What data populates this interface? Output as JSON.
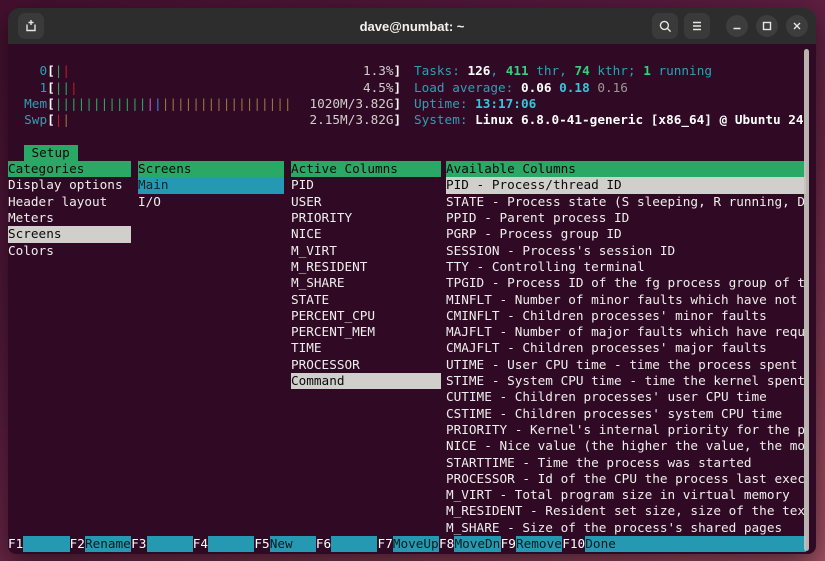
{
  "window": {
    "title": "dave@numbat: ~"
  },
  "titlebar": {
    "icons": [
      "new-tab",
      "search",
      "menu",
      "minimize",
      "maximize",
      "close"
    ]
  },
  "meters": [
    {
      "label": "0",
      "value": "1.3%",
      "bars": [
        [
          "green",
          1
        ],
        [
          "red",
          1
        ]
      ]
    },
    {
      "label": "1",
      "value": "4.5%",
      "bars": [
        [
          "green",
          2
        ],
        [
          "red",
          1
        ]
      ]
    },
    {
      "label": "Mem",
      "value": "1020M/3.82G",
      "bars": [
        [
          "green",
          12
        ],
        [
          "magenta",
          1
        ],
        [
          "blue",
          1
        ],
        [
          "yellow",
          17
        ]
      ]
    },
    {
      "label": "Swp",
      "value": "2.15M/3.82G",
      "bars": [
        [
          "red",
          1
        ],
        [
          "yellow",
          1
        ]
      ]
    }
  ],
  "header_info": [
    [
      [
        "Tasks: ",
        "cy"
      ],
      [
        "126",
        "wb"
      ],
      [
        ", ",
        "cy"
      ],
      [
        "411",
        "gb"
      ],
      [
        " thr, ",
        "cy"
      ],
      [
        "74",
        "gb"
      ],
      [
        " kthr; ",
        "cy"
      ],
      [
        "1",
        "gb"
      ],
      [
        " running",
        "cy"
      ]
    ],
    [
      [
        "Load average: ",
        "cy"
      ],
      [
        "0.06 ",
        "wb"
      ],
      [
        "0.18 ",
        "cb"
      ],
      [
        "0.16",
        "dim"
      ]
    ],
    [
      [
        "Uptime: ",
        "cy"
      ],
      [
        "13:17:06",
        "cb"
      ]
    ],
    [
      [
        "System: ",
        "cy"
      ],
      [
        "Linux 6.8.0-41-generic [x86_64] @ Ubuntu 24",
        "wb"
      ]
    ]
  ],
  "setup": {
    "tab": " Setup ",
    "panels": [
      {
        "id": "categories",
        "header": "Categories",
        "items": [
          {
            "text": "Display options"
          },
          {
            "text": "Header layout"
          },
          {
            "text": "Meters"
          },
          {
            "text": "Screens",
            "sel": "gray"
          },
          {
            "text": "Colors"
          }
        ]
      },
      {
        "id": "screens",
        "header": "Screens",
        "items": [
          {
            "text": "Main",
            "sel": "cyan"
          },
          {
            "text": "I/O"
          }
        ]
      },
      {
        "id": "active-columns",
        "header": "Active Columns",
        "items": [
          {
            "text": "PID"
          },
          {
            "text": "USER"
          },
          {
            "text": "PRIORITY"
          },
          {
            "text": "NICE"
          },
          {
            "text": "M_VIRT"
          },
          {
            "text": "M_RESIDENT"
          },
          {
            "text": "M_SHARE"
          },
          {
            "text": "STATE"
          },
          {
            "text": "PERCENT_CPU"
          },
          {
            "text": "PERCENT_MEM"
          },
          {
            "text": "TIME"
          },
          {
            "text": "PROCESSOR"
          },
          {
            "text": "Command",
            "sel": "gray"
          }
        ]
      },
      {
        "id": "available-columns",
        "header": "Available Columns",
        "items": [
          {
            "text": "PID - Process/thread ID",
            "sel": "gray"
          },
          {
            "text": "STATE - Process state (S sleeping, R running, D"
          },
          {
            "text": "PPID - Parent process ID"
          },
          {
            "text": "PGRP - Process group ID"
          },
          {
            "text": "SESSION - Process's session ID"
          },
          {
            "text": "TTY - Controlling terminal"
          },
          {
            "text": "TPGID - Process ID of the fg process group of th"
          },
          {
            "text": "MINFLT - Number of minor faults which have not r"
          },
          {
            "text": "CMINFLT - Children processes' minor faults"
          },
          {
            "text": "MAJFLT - Number of major faults which have requi"
          },
          {
            "text": "CMAJFLT - Children processes' major faults"
          },
          {
            "text": "UTIME - User CPU time - time the process spent e"
          },
          {
            "text": "STIME - System CPU time - time the kernel spent"
          },
          {
            "text": "CUTIME - Children processes' user CPU time"
          },
          {
            "text": "CSTIME - Children processes' system CPU time"
          },
          {
            "text": "PRIORITY - Kernel's internal priority for the pr"
          },
          {
            "text": "NICE - Nice value (the higher the value, the mor"
          },
          {
            "text": "STARTTIME - Time the process was started"
          },
          {
            "text": "PROCESSOR - Id of the CPU the process last execu"
          },
          {
            "text": "M_VIRT - Total program size in virtual memory"
          },
          {
            "text": "M_RESIDENT - Resident set size, size of the text"
          },
          {
            "text": "M_SHARE - Size of the process's shared pages"
          }
        ]
      }
    ]
  },
  "fnbar": [
    {
      "key": "F1",
      "label": ""
    },
    {
      "key": "F2",
      "label": "Rename"
    },
    {
      "key": "F3",
      "label": ""
    },
    {
      "key": "F4",
      "label": ""
    },
    {
      "key": "F5",
      "label": "New"
    },
    {
      "key": "F6",
      "label": ""
    },
    {
      "key": "F7",
      "label": "MoveUp"
    },
    {
      "key": "F8",
      "label": "MoveDn"
    },
    {
      "key": "F9",
      "label": "Remove"
    },
    {
      "key": "F10",
      "label": "Done"
    }
  ],
  "colors": {
    "terminal_bg": "#300a24",
    "fg": "#eeeeec",
    "green": "#2aa866",
    "cyan": "#2aa1b3",
    "bright_cyan": "#33c7de",
    "bright_green": "#33d17a",
    "red": "#c01c28",
    "blue": "#3584e4",
    "magenta": "#b763c8",
    "yellow": "#9d7444",
    "selection_cyan": "#2599b1",
    "selection_gray": "#d0cfcc"
  }
}
